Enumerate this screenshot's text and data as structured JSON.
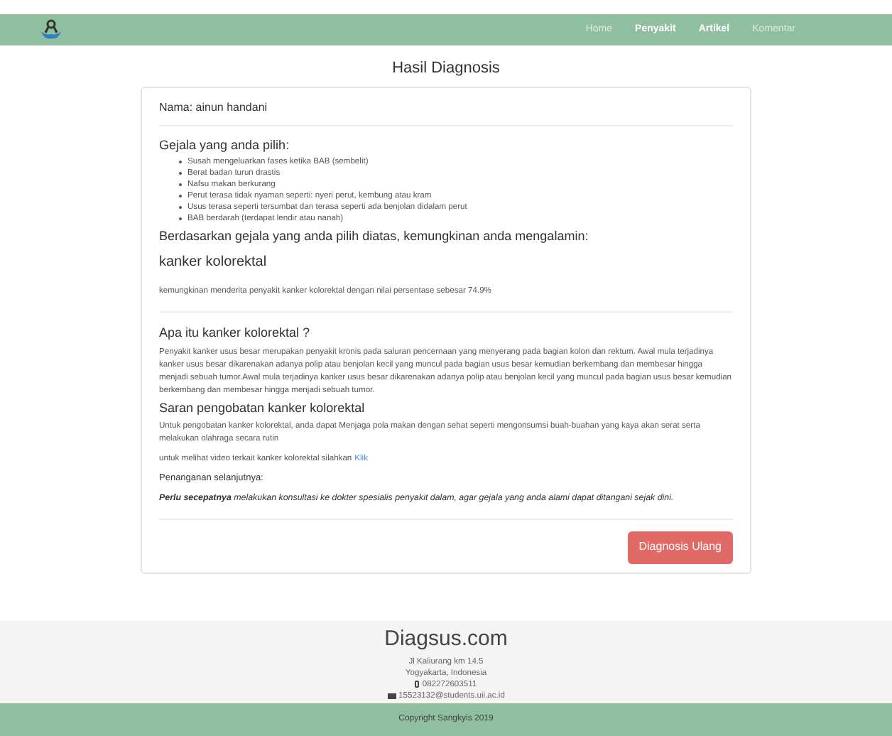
{
  "navbar": {
    "items": [
      {
        "label": "Home",
        "selected": false
      },
      {
        "label": "Penyakit",
        "selected": true
      },
      {
        "label": "Artikel",
        "selected": true
      },
      {
        "label": "Komentar",
        "selected": false
      }
    ]
  },
  "title": "Hasil Diagnosis",
  "result": {
    "name_line": "Nama: ainun handani",
    "symptoms_heading": "Gejala yang anda pilih:",
    "symptoms": [
      "Susah mengeluarkan fases ketika BAB (sembelit)",
      "Berat badan turun drastis",
      "Nafsu makan berkurang",
      "Perut terasa tidak nyaman seperti: nyeri perut, kembung atau kram",
      "Usus terasa seperti tersumbat dan terasa seperti ada benjolan didalam perut",
      "BAB berdarah (terdapat lendir atau nanah)"
    ],
    "conclusion_heading": "Berdasarkan gejala yang anda pilih diatas, kemungkinan anda mengalamin:",
    "disease": "kanker kolorektal",
    "probability": "kemungkinan menderita penyakit kanker kolorektal dengan nilai persentase sebesar 74.9%",
    "about_heading": "Apa itu kanker kolorektal ?",
    "about_text": "Penyakit kanker usus besar merupakan penyakit kronis pada saluran pencernaan yang menyerang pada bagian kolon dan rektum. Awal mula terjadinya kanker usus besar dikarenakan adanya polip atau benjolan kecil yang muncul pada bagian usus besar kemudian berkembang dan membesar hingga menjadi sebuah tumor.Awal mula terjadinya kanker usus besar dikarenakan adanya polip atau benjolan kecil yang muncul pada bagian usus besar kemudian berkembang dan membesar hingga menjadi sebuah tumor.",
    "treatment_heading": "Saran pengobatan kanker kolorektal",
    "treatment_text": "Untuk pengobatan kanker kolorektal, anda dapat Menjaga pola makan dengan sehat seperti mengonsumsi buah-buahan yang kaya akan serat serta melakukan olahraga secara rutin",
    "video_text": "untuk melihat video terkait kanker kolorektal silahkan",
    "video_link": "Klik",
    "next_heading": "Penanganan selanjutnya:",
    "advice": "**Perlu secepatnya** melakukan konsultasi ke dokter spesialis penyakit dalam, agar gejala yang anda alami dapat ditangani sejak dini.",
    "button": "Diagnosis Ulang"
  },
  "footer": {
    "brand": "Diagsus.com",
    "address": [
      "Jl Kaliurang km 14.5",
      "Yogyakarta, Indonesia"
    ],
    "phone": "082272603511",
    "email": "15523132@students.uii.ac.id",
    "copyright": "Copyright Sangkyis 2019"
  }
}
